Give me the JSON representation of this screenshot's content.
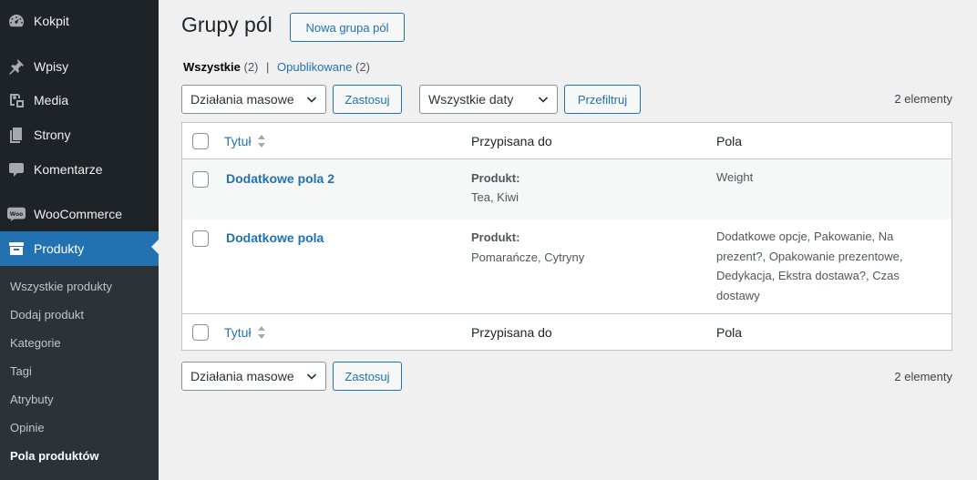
{
  "sidebar": {
    "items": [
      {
        "label": "Kokpit",
        "icon": "dashboard-icon"
      },
      {
        "label": "Wpisy",
        "icon": "pin-icon"
      },
      {
        "label": "Media",
        "icon": "media-icon"
      },
      {
        "label": "Strony",
        "icon": "pages-icon"
      },
      {
        "label": "Komentarze",
        "icon": "comment-icon"
      },
      {
        "label": "WooCommerce",
        "icon": "woocommerce-icon"
      },
      {
        "label": "Produkty",
        "icon": "archive-icon"
      }
    ],
    "submenu": [
      "Wszystkie produkty",
      "Dodaj produkt",
      "Kategorie",
      "Tagi",
      "Atrybuty",
      "Opinie",
      "Pola produktów"
    ],
    "active_item": "Produkty",
    "current_submenu": "Pola produktów"
  },
  "page": {
    "title": "Grupy pól",
    "add_new": "Nowa grupa pól"
  },
  "views": {
    "all_label": "Wszystkie",
    "all_count": "(2)",
    "separator": "|",
    "published_label": "Opublikowane",
    "published_count": "(2)"
  },
  "tablenav_top": {
    "bulk_actions": "Działania masowe",
    "apply": "Zastosuj",
    "dates": "Wszystkie daty",
    "filter": "Przefiltruj",
    "count": "2 elementy"
  },
  "tablenav_bottom": {
    "bulk_actions": "Działania masowe",
    "apply": "Zastosuj",
    "count": "2 elementy"
  },
  "table": {
    "columns": {
      "title": "Tytuł",
      "assigned": "Przypisana do",
      "fields": "Pola"
    },
    "rows": [
      {
        "title": "Dodatkowe pola 2",
        "assigned_label": "Produkt:",
        "assigned_values": "Tea, Kiwi",
        "fields": "Weight"
      },
      {
        "title": "Dodatkowe pola",
        "assigned_label": "Produkt:",
        "assigned_values": "Pomarańcze, Cytryny",
        "fields": "Dodatkowe opcje, Pakowanie, Na prezent?, Opakowanie prezentowe, Dedykacja, Ekstra dostawa?, Czas dostawy"
      }
    ]
  },
  "colors": {
    "sidebar_bg": "#1d2327",
    "submenu_bg": "#2c3338",
    "accent": "#2271b1",
    "page_bg": "#f0f0f1"
  }
}
